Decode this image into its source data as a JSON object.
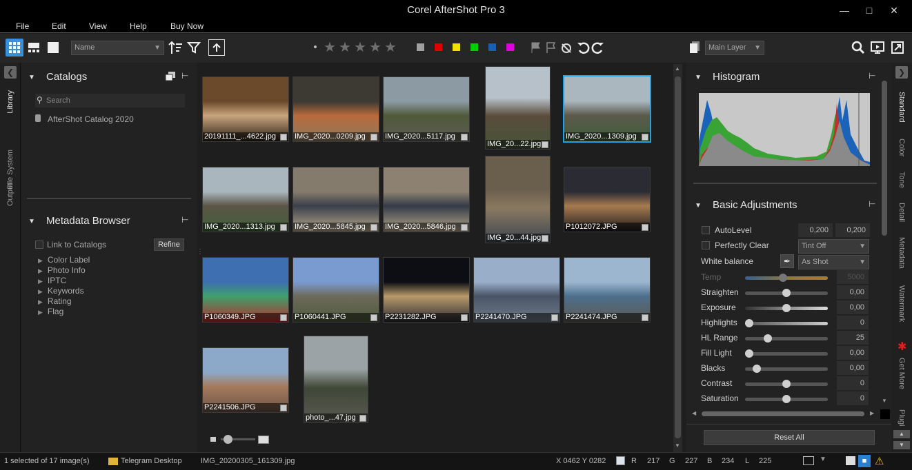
{
  "app": {
    "title": "Corel AfterShot Pro 3"
  },
  "menu": [
    "File",
    "Edit",
    "View",
    "Help",
    "Buy Now"
  ],
  "toolbar": {
    "sort_by": "Name",
    "layer": "Main Layer"
  },
  "swatches": [
    "#a0a0a0",
    "#e00000",
    "#f0e000",
    "#00d000",
    "#1a5fb4",
    "#e000e0"
  ],
  "left_tabs": [
    "Library",
    "File System",
    "Output"
  ],
  "catalogs": {
    "title": "Catalogs",
    "search_placeholder": "Search",
    "items": [
      "AfterShot Catalog 2020"
    ]
  },
  "metadata_browser": {
    "title": "Metadata Browser",
    "link_label": "Link to Catalogs",
    "refine_label": "Refine",
    "items": [
      "Color Label",
      "Photo Info",
      "IPTC",
      "Keywords",
      "Rating",
      "Flag"
    ]
  },
  "thumbnails": [
    {
      "name": "20191111_...4622.jpg",
      "colors": [
        "#6b4a2c",
        "#c9a57d",
        "#2a1e15"
      ]
    },
    {
      "name": "IMG_2020...0209.jpg",
      "colors": [
        "#3c3a33",
        "#b96a3c",
        "#8d7a5e"
      ]
    },
    {
      "name": "IMG_2020...5117.jpg",
      "colors": [
        "#8c9aa3",
        "#4f5a3a",
        "#5d5b54"
      ]
    },
    {
      "name": "IMG_20...22.jpg",
      "colors": [
        "#b7c1c9",
        "#5a4b3a",
        "#46553a"
      ]
    },
    {
      "name": "IMG_2020...1309.jpg",
      "colors": [
        "#aab7bf",
        "#5c5a4c",
        "#3f5e3a"
      ]
    },
    {
      "name": "IMG_2020...1313.jpg",
      "colors": [
        "#a9b6bd",
        "#5b5547",
        "#42603a"
      ]
    },
    {
      "name": "IMG_2020...5845.jpg",
      "colors": [
        "#857b6c",
        "#3a3f4a",
        "#b8a98e"
      ]
    },
    {
      "name": "IMG_2020...5846.jpg",
      "colors": [
        "#8d8271",
        "#343b47",
        "#b6a68b"
      ]
    },
    {
      "name": "IMG_20...44.jpg",
      "colors": [
        "#6a5e4c",
        "#8a7961",
        "#3c4550"
      ]
    },
    {
      "name": "P1012072.JPG",
      "colors": [
        "#2a2b33",
        "#a77a4f",
        "#1b1c20"
      ]
    },
    {
      "name": "P1060349.JPG",
      "colors": [
        "#3e6fb0",
        "#3fa06c",
        "#b82c2a"
      ]
    },
    {
      "name": "P1060441.JPG",
      "colors": [
        "#7a9bd0",
        "#6d6a5b",
        "#4d5a3c"
      ]
    },
    {
      "name": "P2231282.JPG",
      "colors": [
        "#0d0d14",
        "#b89a6a",
        "#2c2b33"
      ]
    },
    {
      "name": "P2241470.JPG",
      "colors": [
        "#98aec9",
        "#4a5466",
        "#6c7a88"
      ]
    },
    {
      "name": "P2241474.JPG",
      "colors": [
        "#9cb6cf",
        "#4c6f8c",
        "#5d5a52"
      ]
    },
    {
      "name": "P2241506.JPG",
      "colors": [
        "#8da9c9",
        "#a57a5d",
        "#6b5545"
      ]
    },
    {
      "name": "photo_...47.jpg",
      "colors": [
        "#9ba3a6",
        "#3f4736",
        "#5a5a52"
      ]
    }
  ],
  "histogram": {
    "title": "Histogram"
  },
  "basic": {
    "title": "Basic Adjustments",
    "autolevel": {
      "label": "AutoLevel",
      "v1": "0,200",
      "v2": "0,200"
    },
    "perfectly_clear": {
      "label": "Perfectly Clear",
      "option": "Tint Off"
    },
    "white_balance": {
      "label": "White balance",
      "option": "As Shot"
    },
    "sliders": [
      {
        "label": "Temp",
        "value": "5000",
        "pos": 0.45,
        "disabled": true
      },
      {
        "label": "Straighten",
        "value": "0,00",
        "pos": 0.5
      },
      {
        "label": "Exposure",
        "value": "0,00",
        "pos": 0.5
      },
      {
        "label": "Highlights",
        "value": "0",
        "pos": 0.0
      },
      {
        "label": "HL Range",
        "value": "25",
        "pos": 0.25
      },
      {
        "label": "Fill Light",
        "value": "0,00",
        "pos": 0.0
      },
      {
        "label": "Blacks",
        "value": "0,00",
        "pos": 0.1
      },
      {
        "label": "Contrast",
        "value": "0",
        "pos": 0.5
      },
      {
        "label": "Saturation",
        "value": "0",
        "pos": 0.5
      }
    ],
    "reset_label": "Reset All"
  },
  "right_tabs": [
    "Standard",
    "Color",
    "Tone",
    "Detail",
    "Metadata",
    "Watermark",
    "Get More",
    "Plugi"
  ],
  "status": {
    "selection": "1 selected of 17 image(s)",
    "folder": "Telegram Desktop",
    "file": "IMG_20200305_161309.jpg",
    "coords": "X 0462  Y 0282",
    "r_label": "R",
    "r": "217",
    "g_label": "G",
    "g": "227",
    "b_label": "B",
    "b": "234",
    "l_label": "L",
    "l": "225"
  }
}
